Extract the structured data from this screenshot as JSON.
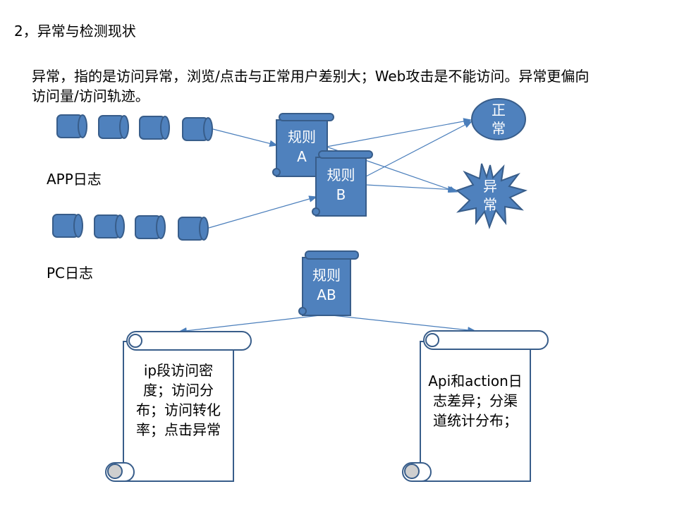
{
  "title": "2，异常与检测现状",
  "description": "异常，指的是访问异常，浏览/点击与正常用户差别大；Web攻击是不能访问。异常更偏向访问量/访问轨迹。",
  "sources": {
    "app_label": "APP日志",
    "pc_label": "PC日志"
  },
  "rules": {
    "rule_a": {
      "line1": "规则",
      "line2": "A"
    },
    "rule_b": {
      "line1": "规则",
      "line2": "B"
    },
    "rule_ab": {
      "line1": "规则",
      "line2": "AB"
    }
  },
  "outcomes": {
    "normal": {
      "line1": "正",
      "line2": "常"
    },
    "anomaly": {
      "line1": "异",
      "line2": "常"
    }
  },
  "notes": {
    "left": "ip段访问密度；访问分布；访问转化率；点击异常",
    "right": "Api和action日志差异；分渠道统计分布；"
  },
  "colors": {
    "shape_fill": "#4f81bd",
    "shape_stroke": "#385d8a",
    "arrow": "#4a7ebb",
    "scroll_stroke": "#385d8a"
  }
}
